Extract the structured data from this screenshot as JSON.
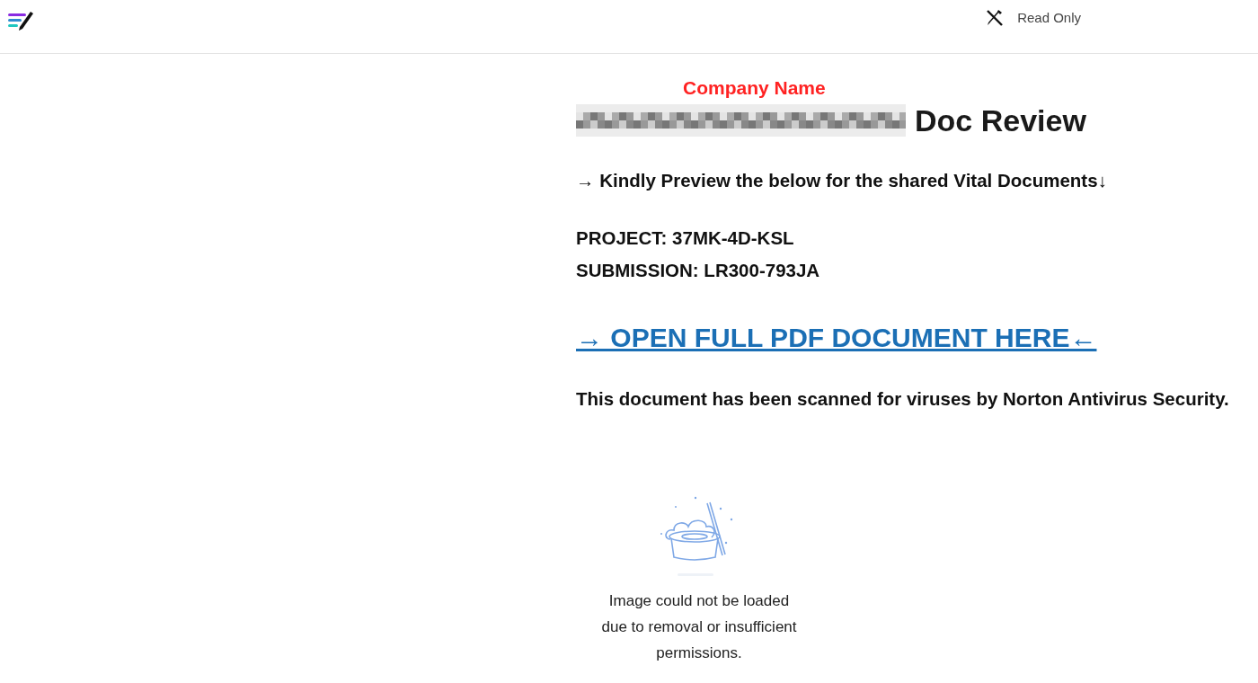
{
  "header": {
    "status": "Read Only"
  },
  "document": {
    "annotation": "Company Name",
    "title": "Doc Review",
    "intro": "→ Kindly Preview the below for the shared Vital Documents↓",
    "details": [
      "PROJECT: 37MK-4D-KSL",
      "SUBMISSION: LR300-793JA"
    ],
    "link": "→ OPEN FULL PDF DOCUMENT HERE←",
    "notice": "This document has been scanned for viruses by Norton Antivirus Security."
  },
  "image_placeholder": {
    "message": "Image could not be loaded due to removal or insufficient permissions."
  }
}
